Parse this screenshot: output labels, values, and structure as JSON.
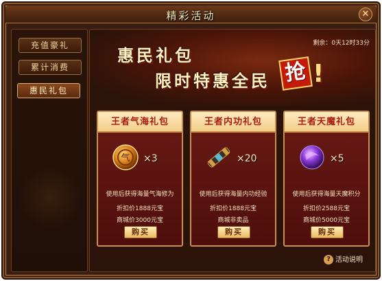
{
  "window": {
    "title": "精彩活动",
    "close_label": "✕"
  },
  "sidebar": {
    "items": [
      {
        "label": "充值豪礼",
        "active": false
      },
      {
        "label": "累计消费",
        "active": false
      },
      {
        "label": "惠民礼包",
        "active": true
      }
    ]
  },
  "banner": {
    "line1": "惠民礼包",
    "line2": "限时特惠全民",
    "grab": "抢",
    "bang": "!",
    "countdown": "剩余：0天12时33分"
  },
  "cards": [
    {
      "title": "王者气海礼包",
      "icon": "qi-sea-orb-icon",
      "qty": "×3",
      "desc": "使用后获得海量气海修为",
      "price": "折扣价1888元宝",
      "mall": "商城价3000元宝",
      "buy_label": "购买"
    },
    {
      "title": "王者内功礼包",
      "icon": "scroll-icon",
      "qty": "×20",
      "desc": "使用后获得海量内功经验",
      "price": "折扣价1888元宝",
      "mall": "商城非卖品",
      "buy_label": "购买"
    },
    {
      "title": "王者天魔礼包",
      "icon": "purple-orb-icon",
      "qty": "×5",
      "desc": "使用后获得海量天魔积分",
      "price": "折扣价2588元宝",
      "mall": "商城价5000元宝",
      "buy_label": "购买"
    }
  ],
  "help": {
    "icon": "?",
    "label": "活动说明"
  },
  "colors": {
    "accent": "#c89048",
    "card_bg": "#5a1410",
    "button": "#e8b860"
  }
}
